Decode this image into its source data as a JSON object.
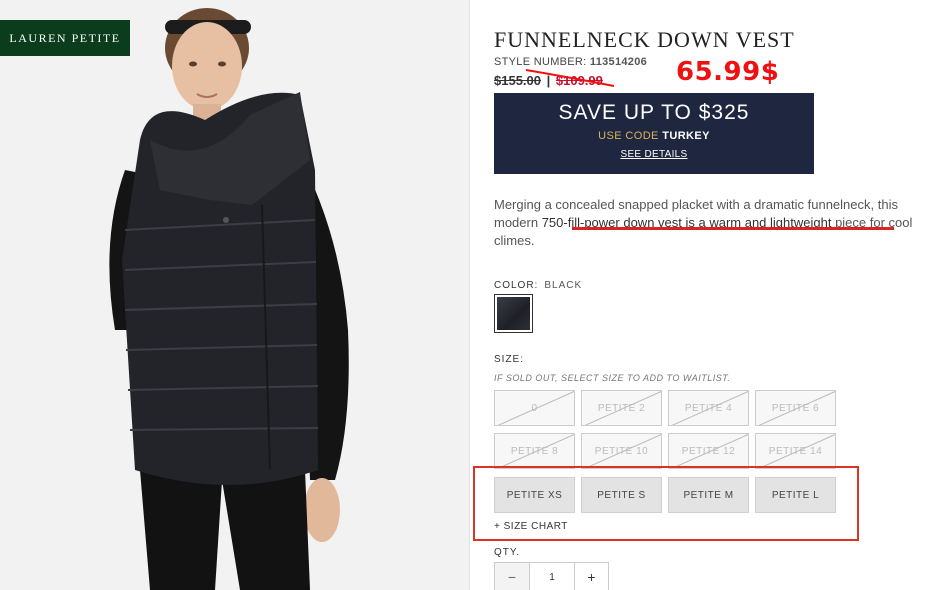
{
  "brand": {
    "badge": "LAUREN PETITE"
  },
  "product": {
    "title": "FUNNELNECK DOWN VEST",
    "style_label": "STYLE NUMBER:",
    "style_number": "113514206",
    "price_original": "$155.00",
    "price_sep": "|",
    "price_sale": "$109.99",
    "annotation_price": "65.99$",
    "description_start": "Merging a concealed snapped placket with a dramatic funnelneck, this modern ",
    "description_highlight": "750-fill-power down vest is a warm and lightweight",
    "description_end": " piece for cool climes."
  },
  "promo": {
    "headline": "SAVE UP TO $325",
    "code_prefix": "USE CODE",
    "code": "TURKEY",
    "details_link": "SEE DETAILS"
  },
  "color": {
    "label": "COLOR:",
    "value": "BLACK"
  },
  "size": {
    "label": "SIZE:",
    "waitlist_note": "IF SOLD OUT, SELECT SIZE TO ADD TO WAITLIST.",
    "options": [
      {
        "label": "0",
        "available": false
      },
      {
        "label": "PETITE 2",
        "available": false
      },
      {
        "label": "PETITE 4",
        "available": false
      },
      {
        "label": "PETITE 6",
        "available": false
      },
      {
        "label": "PETITE 8",
        "available": false
      },
      {
        "label": "PETITE 10",
        "available": false
      },
      {
        "label": "PETITE 12",
        "available": false
      },
      {
        "label": "PETITE 14",
        "available": false
      },
      {
        "label": "PETITE XS",
        "available": true
      },
      {
        "label": "PETITE S",
        "available": true
      },
      {
        "label": "PETITE M",
        "available": true
      },
      {
        "label": "PETITE L",
        "available": true
      }
    ],
    "size_chart_link": "+ SIZE CHART"
  },
  "quantity": {
    "label": "QTY.",
    "value": "1",
    "minus": "−",
    "plus": "+"
  }
}
